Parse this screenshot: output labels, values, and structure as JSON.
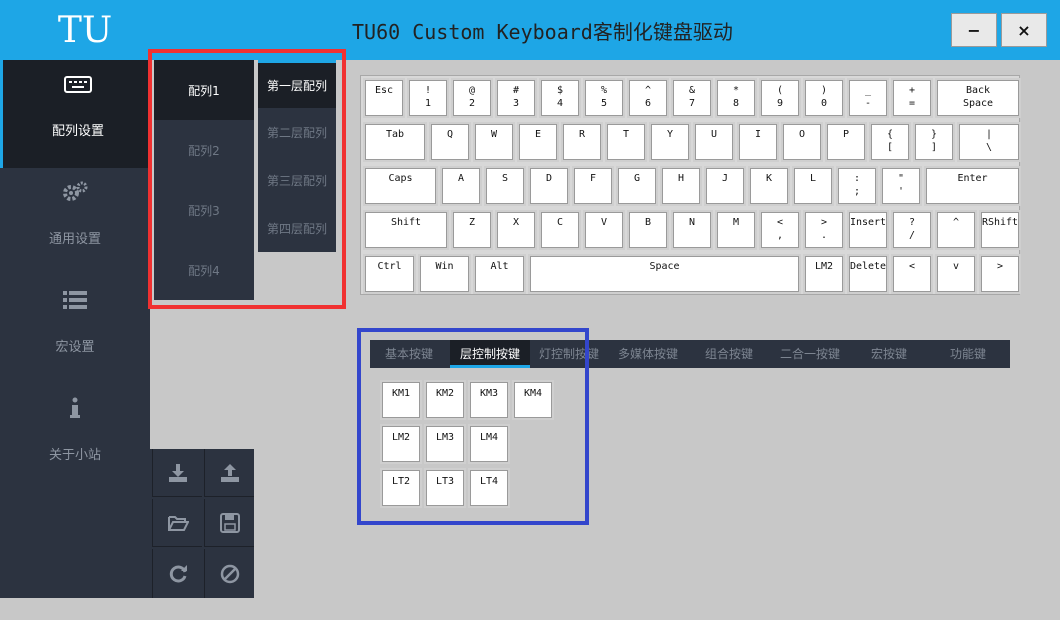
{
  "app": {
    "logo": "TU",
    "title": "TU60 Custom Keyboard客制化键盘驱动"
  },
  "window_controls": {
    "minimize": "−",
    "close": "×"
  },
  "sidebar": {
    "items": [
      {
        "label": "配列设置",
        "icon": "keyboard-icon",
        "active": true
      },
      {
        "label": "通用设置",
        "icon": "gears-icon",
        "active": false
      },
      {
        "label": "宏设置",
        "icon": "list-icon",
        "active": false
      },
      {
        "label": "关于小站",
        "icon": "info-icon",
        "active": false
      }
    ]
  },
  "layouts": [
    "配列1",
    "配列2",
    "配列3",
    "配列4"
  ],
  "layers": [
    "第一层配列",
    "第二层配列",
    "第三层配列",
    "第四层配列"
  ],
  "tools": [
    "download-icon",
    "upload-icon",
    "folder-open-icon",
    "save-icon",
    "refresh-icon",
    "ban-icon"
  ],
  "keyboard": {
    "rows": [
      [
        "Esc",
        "!\n1",
        "@\n2",
        "#\n3",
        "$\n4",
        "%\n5",
        "^\n6",
        "&\n7",
        "*\n8",
        "(\n9",
        ")\n0",
        "_\n-",
        "+\n=",
        "Back\nSpace"
      ],
      [
        "Tab",
        "Q",
        "W",
        "E",
        "R",
        "T",
        "Y",
        "U",
        "I",
        "O",
        "P",
        "{\n[",
        "}\n]",
        "|\n\\"
      ],
      [
        "Caps",
        "A",
        "S",
        "D",
        "F",
        "G",
        "H",
        "J",
        "K",
        "L",
        ":\n;",
        "\"\n'",
        "Enter"
      ],
      [
        "Shift",
        "Z",
        "X",
        "C",
        "V",
        "B",
        "N",
        "M",
        "<\n,",
        ">\n.",
        "Insert",
        "?\n/",
        "^",
        "RShift"
      ],
      [
        "Ctrl",
        "Win",
        "Alt",
        "Space",
        "LM2",
        "Delete",
        "<",
        "v",
        ">"
      ]
    ]
  },
  "function_tabs": [
    "基本按键",
    "层控制按键",
    "灯控制按键",
    "多媒体按键",
    "组合按键",
    "二合一按键",
    "宏按键",
    "功能键"
  ],
  "function_keys": [
    [
      "KM1",
      "KM2",
      "KM3",
      "KM4"
    ],
    [
      "LM2",
      "LM3",
      "LM4"
    ],
    [
      "LT2",
      "LT3",
      "LT4"
    ]
  ]
}
